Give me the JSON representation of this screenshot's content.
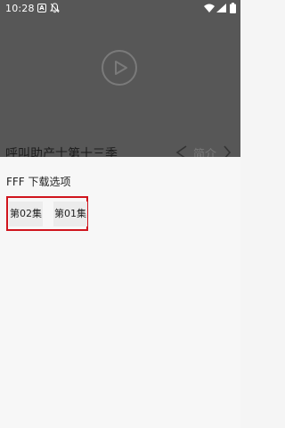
{
  "status_bar": {
    "time": "10:28",
    "notification_letter": "A",
    "icons": [
      "a-badge-icon",
      "bell-off-icon",
      "wifi-icon",
      "signal-icon",
      "battery-icon"
    ]
  },
  "video": {
    "play_icon": "play-icon"
  },
  "title_bar": {
    "episode_title": "呼叫助产士第十三季",
    "intro_label": "简介",
    "share_icon": "share-icon",
    "chevron_icon": "chevron-right-icon"
  },
  "download_sheet": {
    "title": "FFF 下载选项",
    "episodes": [
      {
        "label": "第02集"
      },
      {
        "label": "第01集"
      }
    ],
    "highlight_color": "#d0141d"
  }
}
